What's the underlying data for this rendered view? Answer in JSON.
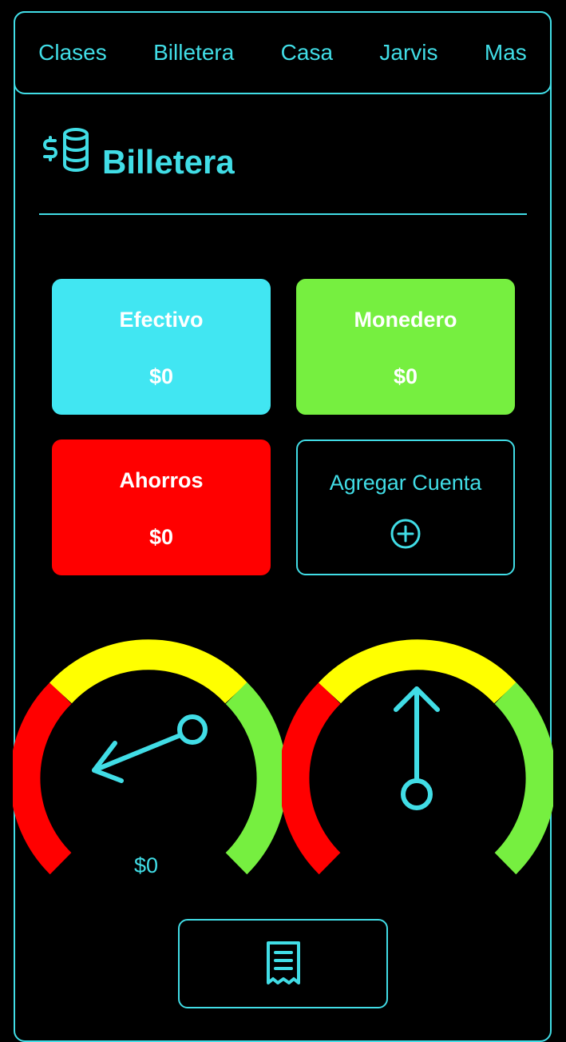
{
  "nav": {
    "items": [
      {
        "label": "Clases"
      },
      {
        "label": "Billetera"
      },
      {
        "label": "Casa"
      },
      {
        "label": "Jarvis"
      },
      {
        "label": "Mas"
      }
    ]
  },
  "header": {
    "icon": "dollar-coins-icon",
    "title": "Billetera"
  },
  "accounts": [
    {
      "name": "Efectivo",
      "amount": "$0",
      "color": "#41e6f2"
    },
    {
      "name": "Monedero",
      "amount": "$0",
      "color": "#76ef40"
    },
    {
      "name": "Ahorros",
      "amount": "$0",
      "color": "#ff0000"
    }
  ],
  "add_account": {
    "label": "Agregar Cuenta",
    "icon": "plus-circle-icon"
  },
  "gauges": {
    "left": {
      "value_label": "$0"
    },
    "colors": {
      "low": "#ff0000",
      "mid": "#ffff00",
      "high": "#76ef40",
      "needle": "#41dde6"
    }
  },
  "footer": {
    "receipt_icon": "receipt-icon"
  }
}
